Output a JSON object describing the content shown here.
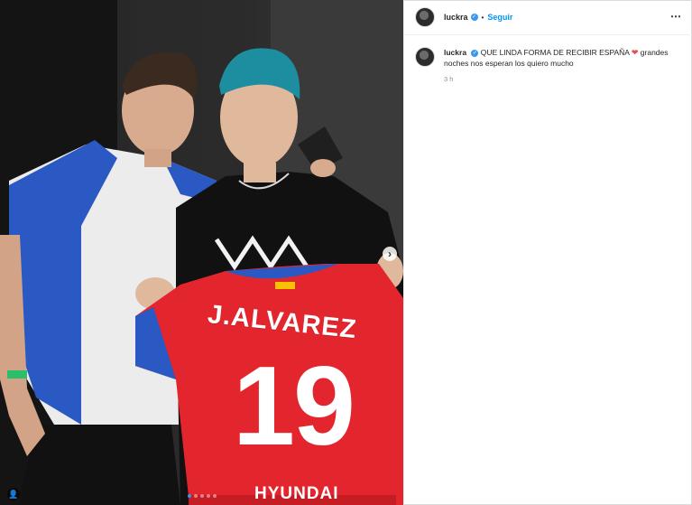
{
  "post": {
    "jersey": {
      "name": "J.ALVAREZ",
      "number": "19",
      "sponsor": "HYUNDAI"
    },
    "carousel": {
      "total": 5,
      "active": 0
    }
  },
  "header": {
    "username": "luckra",
    "separator": "•",
    "follow_label": "Seguir",
    "more_icon": "⋯"
  },
  "caption": {
    "username": "luckra",
    "text_part1": "QUE LINDA FORMA DE RECIBIR ESPAÑA",
    "emoji": "❤",
    "text_part2": "grandes noches nos esperan los quiero mucho",
    "timestamp": "3 h"
  },
  "icons": {
    "verified": "✓",
    "next": "›",
    "tag": "👤"
  },
  "colors": {
    "accent": "#0095f6",
    "verified": "#3897f0",
    "heart": "#ed4956",
    "jersey_red": "#e3262e"
  }
}
